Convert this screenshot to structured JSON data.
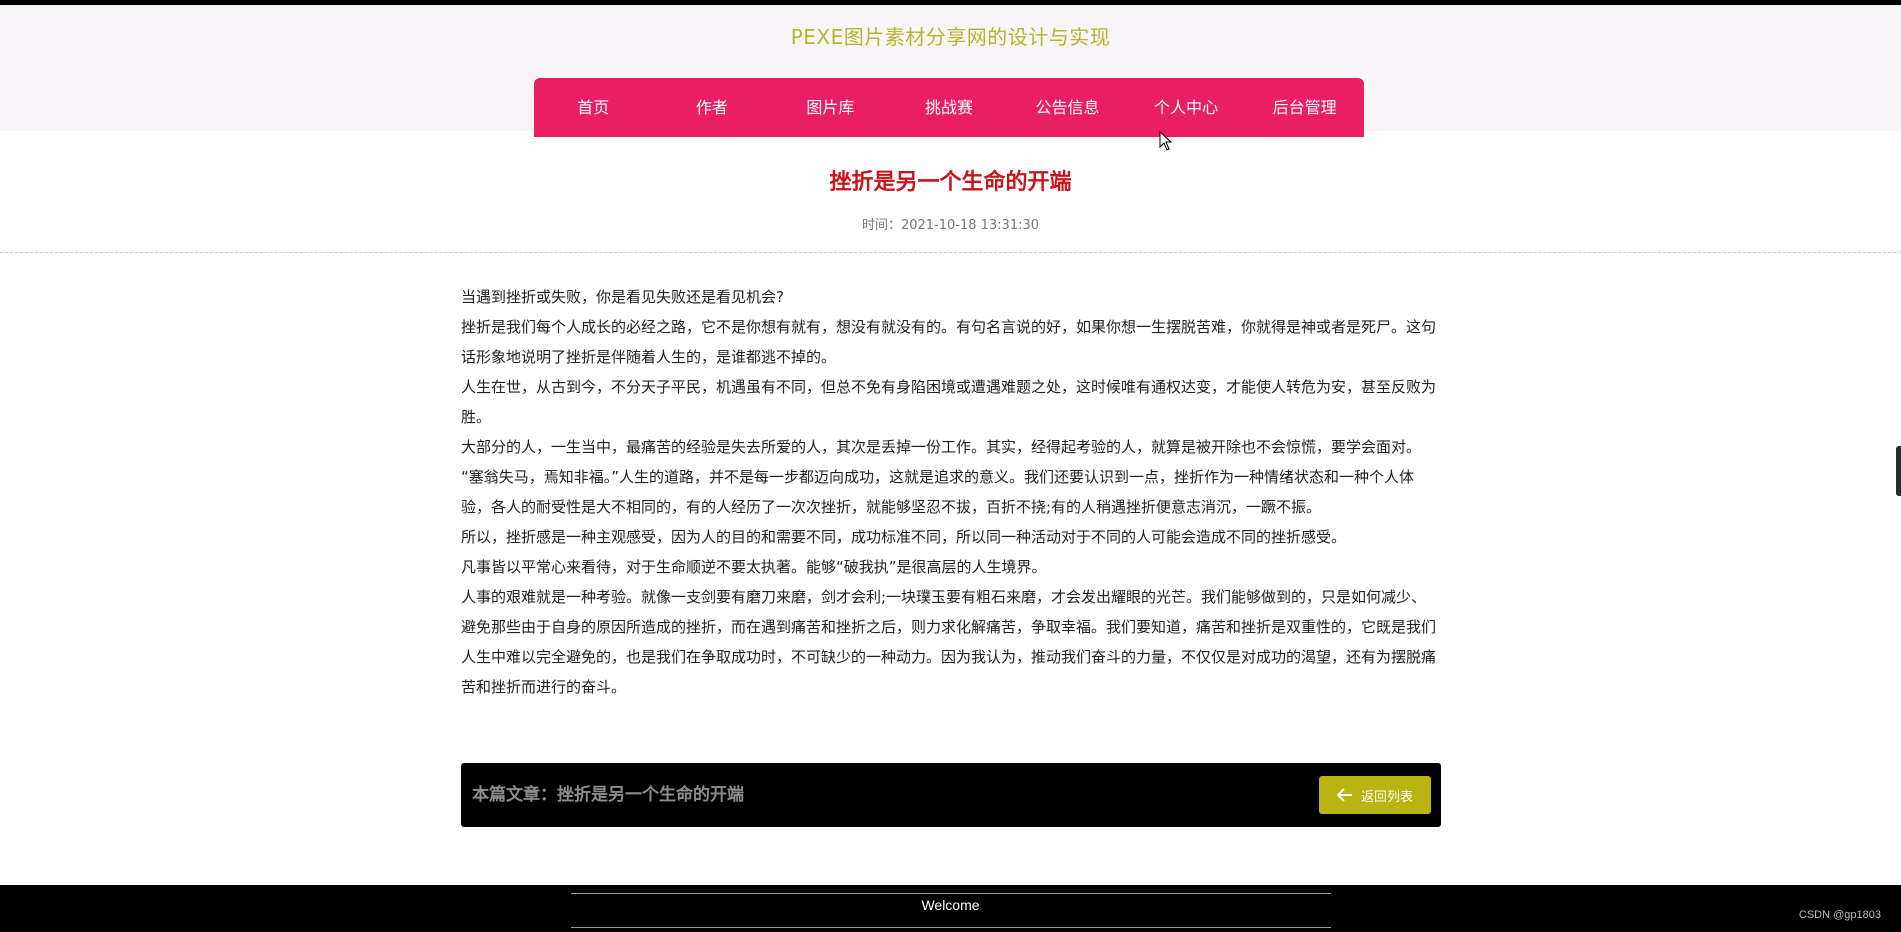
{
  "site": {
    "title": "PEXE图片素材分享网的设计与实现"
  },
  "nav": {
    "items": [
      {
        "label": "首页"
      },
      {
        "label": "作者"
      },
      {
        "label": "图片库"
      },
      {
        "label": "挑战赛"
      },
      {
        "label": "公告信息"
      },
      {
        "label": "个人中心"
      },
      {
        "label": "后台管理"
      }
    ]
  },
  "article": {
    "title": "挫折是另一个生命的开端",
    "time": "时间：2021-10-18 13:31:30",
    "paragraphs": [
      "当遇到挫折或失败，你是看见失败还是看见机会?",
      "挫折是我们每个人成长的必经之路，它不是你想有就有，想没有就没有的。有句名言说的好，如果你想一生摆脱苦难，你就得是神或者是死尸。这句话形象地说明了挫折是伴随着人生的，是谁都逃不掉的。",
      "人生在世，从古到今，不分天子平民，机遇虽有不同，但总不免有身陷困境或遭遇难题之处，这时候唯有通权达变，才能使人转危为安，甚至反败为胜。",
      "大部分的人，一生当中，最痛苦的经验是失去所爱的人，其次是丢掉一份工作。其实，经得起考验的人，就算是被开除也不会惊慌，要学会面对。",
      "“塞翁失马，焉知非福。”人生的道路，并不是每一步都迈向成功，这就是追求的意义。我们还要认识到一点，挫折作为一种情绪状态和一种个人体验，各人的耐受性是大不相同的，有的人经历了一次次挫折，就能够坚忍不拔，百折不挠;有的人稍遇挫折便意志消沉，一蹶不振。",
      "所以，挫折感是一种主观感受，因为人的目的和需要不同，成功标准不同，所以同一种活动对于不同的人可能会造成不同的挫折感受。",
      "凡事皆以平常心来看待，对于生命顺逆不要太执著。能够“破我执”是很高层的人生境界。",
      "人事的艰难就是一种考验。就像一支剑要有磨刀来磨，剑才会利;一块璞玉要有粗石来磨，才会发出耀眼的光芒。我们能够做到的，只是如何减少、避免那些由于自身的原因所造成的挫折，而在遇到痛苦和挫折之后，则力求化解痛苦，争取幸福。我们要知道，痛苦和挫折是双重性的，它既是我们人生中难以完全避免的，也是我们在争取成功时，不可缺少的一种动力。因为我认为，推动我们奋斗的力量，不仅仅是对成功的渴望，还有为摆脱痛苦和挫折而进行的奋斗。"
    ]
  },
  "article_footer": {
    "label": "本篇文章：挫折是另一个生命的开端",
    "back_label": "返回列表",
    "back_icon": "arrow-left-icon",
    "back_color": "#b9b411"
  },
  "footer": {
    "welcome": "Welcome",
    "watermark": "CSDN @gp1803"
  },
  "colors": {
    "nav": "#ea1f63",
    "title": "#c8151b",
    "site_title": "#b7b52a"
  }
}
